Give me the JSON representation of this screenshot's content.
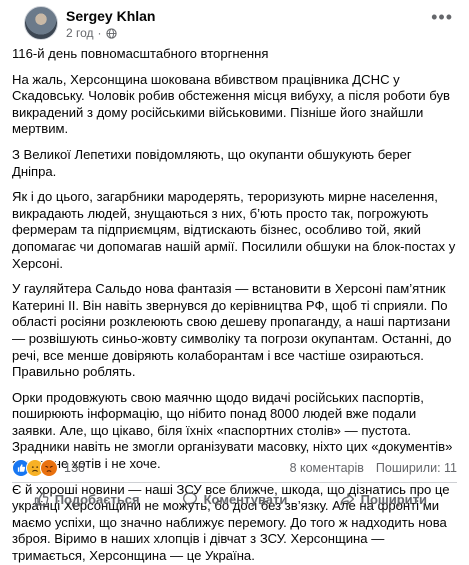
{
  "post": {
    "author": "Sergey Khlan",
    "time": "2 год",
    "title": "116-й день повномасштабного вторгнення",
    "paragraphs": [
      "На жаль, Херсонщина шокована вбивством працівника ДСНС у Скадовську. Чоловік робив обстеження місця вибуху, а після роботи був викрадений з дому російськими військовими. Пізніше його знайшли мертвим.",
      "З Великої Лепетихи повідомляють, що окупанти обшукують берег Дніпра.",
      "Як і до цього, загарбники мародерять, тероризують мирне населення, викрадають людей, знущаються з них, б’ють просто так, погрожують фермерам та підприємцям, відтискають бізнес, особливо той, який допомагає чи допомагав нашій армії. Посилили обшуки на блок-постах у Херсоні.",
      "У гауляйтера Сальдо нова фантазія — встановити в Херсоні пам’ятник Катерині ІІ. Він навіть звернувся до керівництва РФ, щоб ті сприяли. По області росіяни розклеюють свою дешеву пропаганду, а наші партизани — розвішують синьо-жовту символіку та погрози окупантам. Останні, до речі, все менше довіряють колаборантам і все частіше озираються. Правильно роблять.",
      "Орки продовжують свою маячню щодо видачі російських паспортів, поширюють інформацію, що нібито понад 8000 людей вже подали заявки. Але, що цікаво, біля їхніх «паспортних столів» — пустота. Зрадники навіть не змогли організувати масовку, ніхто цих «документів» з роду не хотів і не хоче.",
      "Є й хороші новини — наші ЗСУ все ближче, шкода, що дізнатись про це українці Херсонщини не можуть, бо досі без зв’язку. Але на фронті ми маємо успіхи, що значно наближує перемогу. До того ж надходить нова зброя. Віримо в наших хлопців і дівчат з ЗСУ. Херсонщина — тримається, Херсонщина — це Україна."
    ]
  },
  "stats": {
    "reactions_count": "136",
    "comments": "8 коментарів",
    "shares": "Поширили: 11"
  },
  "actions": {
    "like": "Подобається",
    "comment": "Коментувати",
    "share": "Поширити"
  },
  "icons": {
    "privacy": "globe-icon",
    "menu": "more-options-icon",
    "reactions": [
      "like-icon",
      "sad-icon",
      "angry-icon"
    ],
    "like": "thumbs-up-icon",
    "comment": "speech-bubble-icon",
    "share": "share-arrow-icon"
  },
  "colors": {
    "like_blue": "#1877f2",
    "secondary_text": "#65676b",
    "divider": "#ced0d4"
  }
}
